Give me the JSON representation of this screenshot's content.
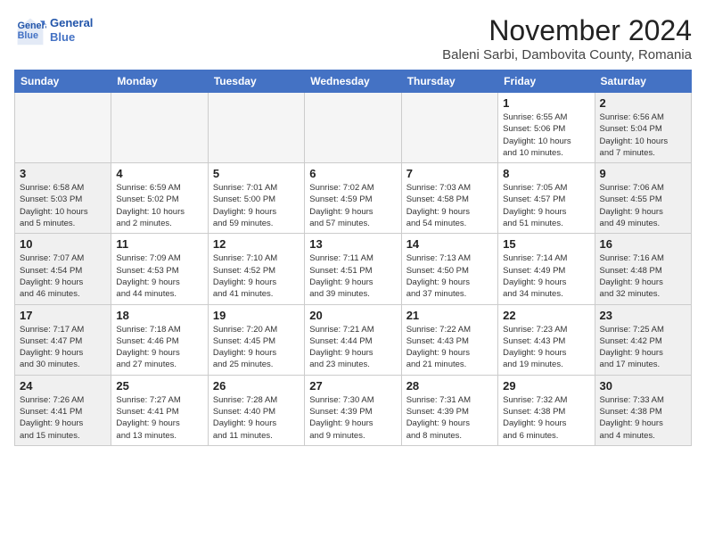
{
  "header": {
    "logo_general": "General",
    "logo_blue": "Blue",
    "month_title": "November 2024",
    "subtitle": "Baleni Sarbi, Dambovita County, Romania"
  },
  "weekdays": [
    "Sunday",
    "Monday",
    "Tuesday",
    "Wednesday",
    "Thursday",
    "Friday",
    "Saturday"
  ],
  "weeks": [
    [
      {
        "day": "",
        "detail": ""
      },
      {
        "day": "",
        "detail": ""
      },
      {
        "day": "",
        "detail": ""
      },
      {
        "day": "",
        "detail": ""
      },
      {
        "day": "",
        "detail": ""
      },
      {
        "day": "1",
        "detail": "Sunrise: 6:55 AM\nSunset: 5:06 PM\nDaylight: 10 hours\nand 10 minutes."
      },
      {
        "day": "2",
        "detail": "Sunrise: 6:56 AM\nSunset: 5:04 PM\nDaylight: 10 hours\nand 7 minutes."
      }
    ],
    [
      {
        "day": "3",
        "detail": "Sunrise: 6:58 AM\nSunset: 5:03 PM\nDaylight: 10 hours\nand 5 minutes."
      },
      {
        "day": "4",
        "detail": "Sunrise: 6:59 AM\nSunset: 5:02 PM\nDaylight: 10 hours\nand 2 minutes."
      },
      {
        "day": "5",
        "detail": "Sunrise: 7:01 AM\nSunset: 5:00 PM\nDaylight: 9 hours\nand 59 minutes."
      },
      {
        "day": "6",
        "detail": "Sunrise: 7:02 AM\nSunset: 4:59 PM\nDaylight: 9 hours\nand 57 minutes."
      },
      {
        "day": "7",
        "detail": "Sunrise: 7:03 AM\nSunset: 4:58 PM\nDaylight: 9 hours\nand 54 minutes."
      },
      {
        "day": "8",
        "detail": "Sunrise: 7:05 AM\nSunset: 4:57 PM\nDaylight: 9 hours\nand 51 minutes."
      },
      {
        "day": "9",
        "detail": "Sunrise: 7:06 AM\nSunset: 4:55 PM\nDaylight: 9 hours\nand 49 minutes."
      }
    ],
    [
      {
        "day": "10",
        "detail": "Sunrise: 7:07 AM\nSunset: 4:54 PM\nDaylight: 9 hours\nand 46 minutes."
      },
      {
        "day": "11",
        "detail": "Sunrise: 7:09 AM\nSunset: 4:53 PM\nDaylight: 9 hours\nand 44 minutes."
      },
      {
        "day": "12",
        "detail": "Sunrise: 7:10 AM\nSunset: 4:52 PM\nDaylight: 9 hours\nand 41 minutes."
      },
      {
        "day": "13",
        "detail": "Sunrise: 7:11 AM\nSunset: 4:51 PM\nDaylight: 9 hours\nand 39 minutes."
      },
      {
        "day": "14",
        "detail": "Sunrise: 7:13 AM\nSunset: 4:50 PM\nDaylight: 9 hours\nand 37 minutes."
      },
      {
        "day": "15",
        "detail": "Sunrise: 7:14 AM\nSunset: 4:49 PM\nDaylight: 9 hours\nand 34 minutes."
      },
      {
        "day": "16",
        "detail": "Sunrise: 7:16 AM\nSunset: 4:48 PM\nDaylight: 9 hours\nand 32 minutes."
      }
    ],
    [
      {
        "day": "17",
        "detail": "Sunrise: 7:17 AM\nSunset: 4:47 PM\nDaylight: 9 hours\nand 30 minutes."
      },
      {
        "day": "18",
        "detail": "Sunrise: 7:18 AM\nSunset: 4:46 PM\nDaylight: 9 hours\nand 27 minutes."
      },
      {
        "day": "19",
        "detail": "Sunrise: 7:20 AM\nSunset: 4:45 PM\nDaylight: 9 hours\nand 25 minutes."
      },
      {
        "day": "20",
        "detail": "Sunrise: 7:21 AM\nSunset: 4:44 PM\nDaylight: 9 hours\nand 23 minutes."
      },
      {
        "day": "21",
        "detail": "Sunrise: 7:22 AM\nSunset: 4:43 PM\nDaylight: 9 hours\nand 21 minutes."
      },
      {
        "day": "22",
        "detail": "Sunrise: 7:23 AM\nSunset: 4:43 PM\nDaylight: 9 hours\nand 19 minutes."
      },
      {
        "day": "23",
        "detail": "Sunrise: 7:25 AM\nSunset: 4:42 PM\nDaylight: 9 hours\nand 17 minutes."
      }
    ],
    [
      {
        "day": "24",
        "detail": "Sunrise: 7:26 AM\nSunset: 4:41 PM\nDaylight: 9 hours\nand 15 minutes."
      },
      {
        "day": "25",
        "detail": "Sunrise: 7:27 AM\nSunset: 4:41 PM\nDaylight: 9 hours\nand 13 minutes."
      },
      {
        "day": "26",
        "detail": "Sunrise: 7:28 AM\nSunset: 4:40 PM\nDaylight: 9 hours\nand 11 minutes."
      },
      {
        "day": "27",
        "detail": "Sunrise: 7:30 AM\nSunset: 4:39 PM\nDaylight: 9 hours\nand 9 minutes."
      },
      {
        "day": "28",
        "detail": "Sunrise: 7:31 AM\nSunset: 4:39 PM\nDaylight: 9 hours\nand 8 minutes."
      },
      {
        "day": "29",
        "detail": "Sunrise: 7:32 AM\nSunset: 4:38 PM\nDaylight: 9 hours\nand 6 minutes."
      },
      {
        "day": "30",
        "detail": "Sunrise: 7:33 AM\nSunset: 4:38 PM\nDaylight: 9 hours\nand 4 minutes."
      }
    ]
  ]
}
